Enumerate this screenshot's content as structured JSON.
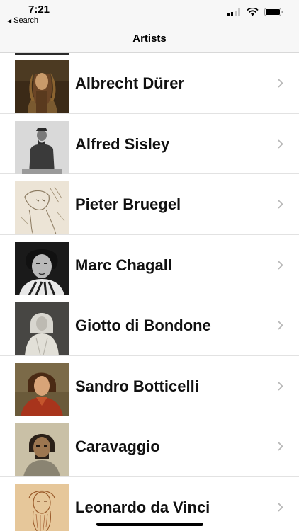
{
  "status_bar": {
    "time": "7:21",
    "back_label": "Search"
  },
  "nav": {
    "title": "Artists"
  },
  "artists": [
    {
      "name": "Albrecht Dürer"
    },
    {
      "name": "Alfred Sisley"
    },
    {
      "name": "Pieter Bruegel"
    },
    {
      "name": "Marc Chagall"
    },
    {
      "name": "Giotto di Bondone"
    },
    {
      "name": "Sandro Botticelli"
    },
    {
      "name": "Caravaggio"
    },
    {
      "name": "Leonardo da Vinci"
    }
  ],
  "colors": {
    "nav_bg": "#f7f7f7",
    "separator": "#e2e2e2",
    "chevron": "#b8b8b8",
    "text": "#111111"
  }
}
